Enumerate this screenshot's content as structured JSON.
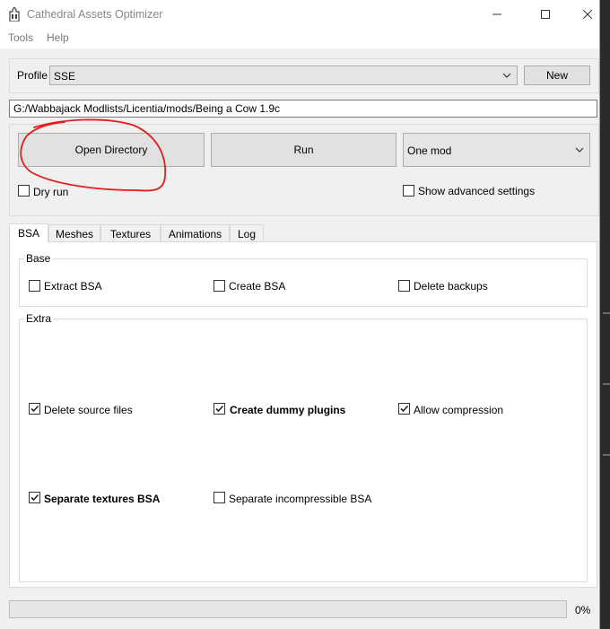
{
  "window": {
    "title": "Cathedral Assets Optimizer"
  },
  "menu": {
    "items": [
      "Tools",
      "Help"
    ]
  },
  "profile": {
    "label": "Profile",
    "selected": "SSE",
    "new_label": "New"
  },
  "path": {
    "value": "G:/Wabbajack Modlists/Licentia/mods/Being a Cow 1.9c"
  },
  "actions": {
    "open_directory": "Open Directory",
    "run": "Run",
    "mode_selected": "One mod",
    "dry_run": "Dry run",
    "dry_run_checked": false,
    "show_advanced": "Show advanced settings",
    "show_advanced_checked": false
  },
  "tabs": [
    "BSA",
    "Meshes",
    "Textures",
    "Animations",
    "Log"
  ],
  "active_tab": "BSA",
  "bsa": {
    "base_title": "Base",
    "base": [
      {
        "label": "Extract BSA",
        "checked": false,
        "bold": false
      },
      {
        "label": "Create BSA",
        "checked": false,
        "bold": false
      },
      {
        "label": "Delete backups",
        "checked": false,
        "bold": false
      }
    ],
    "extra_title": "Extra",
    "extra": [
      {
        "label": "Delete source files",
        "checked": true,
        "bold": false
      },
      {
        "label": "Create dummy plugins",
        "checked": true,
        "bold": true
      },
      {
        "label": "Allow compression",
        "checked": true,
        "bold": false
      },
      {
        "label": "Separate textures BSA",
        "checked": true,
        "bold": true
      },
      {
        "label": "Separate incompressible BSA",
        "checked": false,
        "bold": false
      }
    ]
  },
  "progress": {
    "value": 0,
    "text": "0%"
  },
  "colors": {
    "annotation": "#e0201e",
    "window_bg": "#f0f0f0",
    "titlebar_bg": "#ffffff"
  }
}
